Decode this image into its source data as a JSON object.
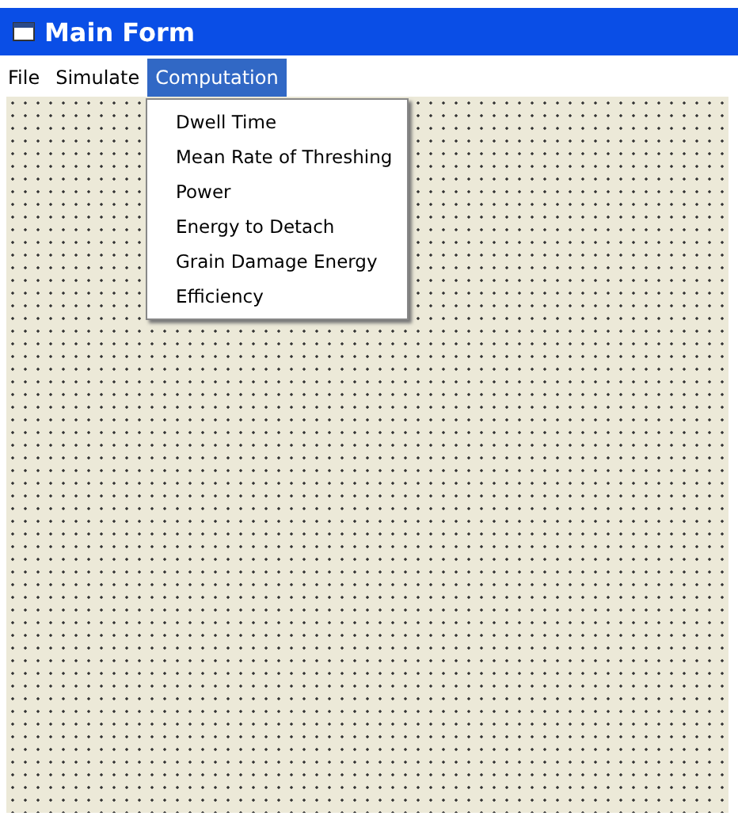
{
  "window": {
    "title": "Main Form"
  },
  "menu_bar": [
    {
      "label": "File",
      "selected": false
    },
    {
      "label": "Simulate",
      "selected": false
    },
    {
      "label": "Computation",
      "selected": true
    }
  ],
  "dropdown": {
    "items": [
      {
        "label": "Dwell Time"
      },
      {
        "label": "Mean Rate of Threshing"
      },
      {
        "label": "Power"
      },
      {
        "label": "Energy to Detach"
      },
      {
        "label": "Grain Damage Energy"
      },
      {
        "label": "Efficiency"
      }
    ]
  }
}
